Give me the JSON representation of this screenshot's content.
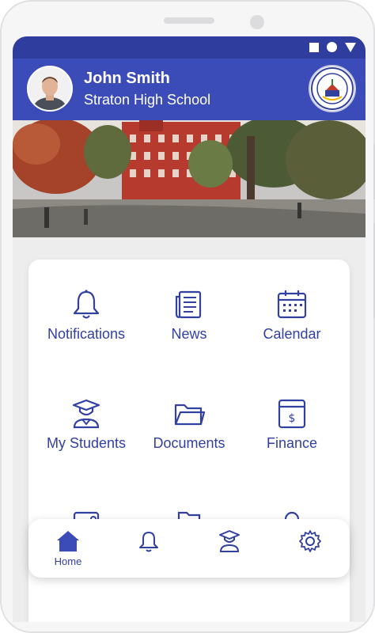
{
  "profile": {
    "name": "John Smith",
    "school": "Straton High School"
  },
  "menu": [
    {
      "label": "Notifications",
      "icon": "bell-icon"
    },
    {
      "label": "News",
      "icon": "newspaper-icon"
    },
    {
      "label": "Calendar",
      "icon": "calendar-icon"
    },
    {
      "label": "My Students",
      "icon": "graduate-icon"
    },
    {
      "label": "Documents",
      "icon": "folder-icon"
    },
    {
      "label": "Finance",
      "icon": "finance-icon"
    }
  ],
  "bottom_nav": {
    "home_label": "Home",
    "items": [
      "home-icon",
      "bell-icon",
      "graduate-icon",
      "gear-icon"
    ]
  },
  "colors": {
    "primary": "#3b4cb8",
    "status_bar": "#2f3e9e",
    "icon": "#3240a0"
  }
}
